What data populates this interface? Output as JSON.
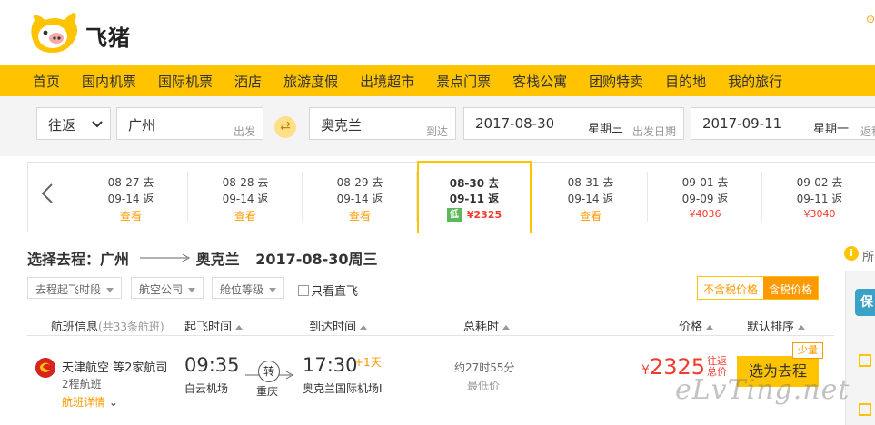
{
  "brand": {
    "name": "飞猪"
  },
  "nav": {
    "items": [
      "首页",
      "国内机票",
      "国际机票",
      "酒店",
      "旅游度假",
      "出境超市",
      "景点门票",
      "客栈公寓",
      "团购特卖",
      "目的地",
      "我的旅行"
    ]
  },
  "search": {
    "trip_type": "往返",
    "from_city": "广州",
    "from_hint": "出发",
    "to_city": "奥克兰",
    "to_hint": "到达",
    "depart_date": "2017-08-30",
    "depart_week": "星期三",
    "depart_hint": "出发日期",
    "return_date": "2017-09-11",
    "return_week": "星期一",
    "return_hint": "返程"
  },
  "date_strip": [
    {
      "go": "08-27 去",
      "back": "09-14 返",
      "action": "查看"
    },
    {
      "go": "08-28 去",
      "back": "09-14 返",
      "action": "查看"
    },
    {
      "go": "08-29 去",
      "back": "09-14 返",
      "action": "查看"
    },
    {
      "go": "08-30 去",
      "back": "09-11 返",
      "badge": "低",
      "price": "¥2325",
      "active": true
    },
    {
      "go": "08-31 去",
      "back": "09-14 返",
      "action": "查看"
    },
    {
      "go": "09-01 去",
      "back": "09-09 返",
      "price": "¥4036"
    },
    {
      "go": "09-02 去",
      "back": "09-11 返",
      "price": "¥3040"
    }
  ],
  "route": {
    "label": "选择去程：",
    "from": "广州",
    "to": "奥克兰",
    "date": "2017-08-30周三"
  },
  "info": {
    "text": "所有"
  },
  "filters": {
    "dep_time": "去程起飞时段",
    "airline": "航空公司",
    "cabin": "舱位等级",
    "direct": "只看直飞"
  },
  "tax": {
    "excl": "不含税价格",
    "incl": "含税价格"
  },
  "table_header": {
    "flight_info": "航班信息",
    "flight_count": "(共33条航班)",
    "dep_time": "起飞时间",
    "arr_time": "到达时间",
    "duration": "总耗时",
    "price": "价格",
    "sort": "默认排序"
  },
  "flight": {
    "airline": "天津航空 等2家航司",
    "flights": "2程航班",
    "detail": "航班详情",
    "dep_time": "09:35",
    "dep_airport": "白云机场",
    "transfer": "转",
    "transfer_city": "重庆",
    "arr_time": "17:30",
    "arr_day": "+1天",
    "arr_airport": "奥克兰国际机场I",
    "duration": "约27时55分",
    "tag": "最低价",
    "currency": "¥",
    "price": "2325",
    "price_tag": "往返总价",
    "book": "选为去程",
    "seats": "少量"
  },
  "sidebar": {
    "insurance": "保"
  },
  "watermark": "eLvTing.net",
  "colors": {
    "brand_yellow": "#ffc300",
    "accent_orange": "#ff9900",
    "price_red": "#f03c2d"
  }
}
